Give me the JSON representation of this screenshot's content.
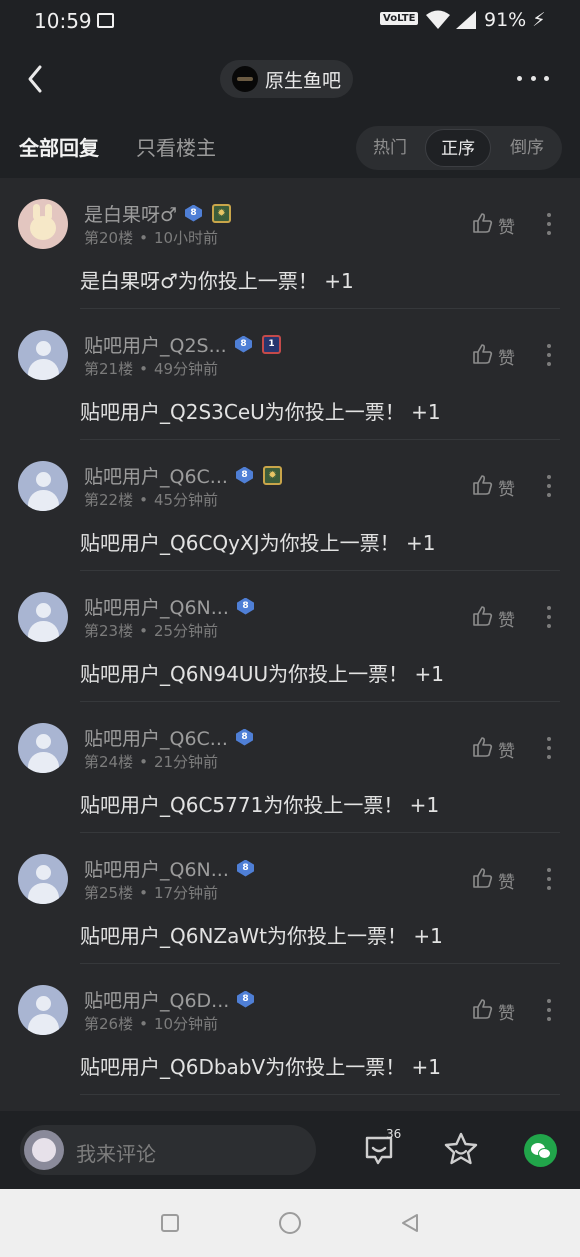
{
  "status_bar": {
    "time": "10:59",
    "network_label": "VoLTE",
    "battery": "91%"
  },
  "header": {
    "forum_name": "原生鱼吧"
  },
  "tabs": {
    "all_replies": "全部回复",
    "op_only": "只看楼主"
  },
  "sort": {
    "hot": "热门",
    "asc": "正序",
    "desc": "倒序",
    "selected": "正序"
  },
  "posts": [
    {
      "username": "是白果呀♂",
      "level": "8",
      "floor": "第20楼",
      "time": "10小时前",
      "like_label": "赞",
      "content": "是白果呀♂为你投上一票！ +1",
      "badge": "gold",
      "avatar": "bunny"
    },
    {
      "username": "贴吧用户_Q2S...",
      "level": "8",
      "floor": "第21楼",
      "time": "49分钟前",
      "like_label": "赞",
      "content": "贴吧用户_Q2S3CeU为你投上一票！ +1",
      "badge": "navy",
      "avatar": "default"
    },
    {
      "username": "贴吧用户_Q6C...",
      "level": "8",
      "floor": "第22楼",
      "time": "45分钟前",
      "like_label": "赞",
      "content": "贴吧用户_Q6CQyXJ为你投上一票！ +1",
      "badge": "gold",
      "avatar": "default"
    },
    {
      "username": "贴吧用户_Q6N...",
      "level": "8",
      "floor": "第23楼",
      "time": "25分钟前",
      "like_label": "赞",
      "content": "贴吧用户_Q6N94UU为你投上一票！ +1",
      "badge": "none",
      "avatar": "default"
    },
    {
      "username": "贴吧用户_Q6C...",
      "level": "8",
      "floor": "第24楼",
      "time": "21分钟前",
      "like_label": "赞",
      "content": "贴吧用户_Q6C5771为你投上一票！ +1",
      "badge": "none",
      "avatar": "default"
    },
    {
      "username": "贴吧用户_Q6N...",
      "level": "8",
      "floor": "第25楼",
      "time": "17分钟前",
      "like_label": "赞",
      "content": "贴吧用户_Q6NZaWt为你投上一票！ +1",
      "badge": "none",
      "avatar": "default"
    },
    {
      "username": "贴吧用户_Q6D...",
      "level": "8",
      "floor": "第26楼",
      "time": "10分钟前",
      "like_label": "赞",
      "content": "贴吧用户_Q6DbabV为你投上一票！ +1",
      "badge": "none",
      "avatar": "default"
    }
  ],
  "bottom_bar": {
    "comment_placeholder": "我来评论",
    "reply_count": "36"
  },
  "colors": {
    "background": "#1f2124",
    "list_bg": "#28292c",
    "level_badge": "#4f7fd6",
    "wechat": "#21a54a"
  },
  "icons": {
    "back": "chevron-left-icon",
    "more": "more-horizontal-icon",
    "like": "thumbs-up-icon",
    "reply": "comment-bubble-icon",
    "favorite": "star-icon",
    "share": "wechat-icon"
  }
}
